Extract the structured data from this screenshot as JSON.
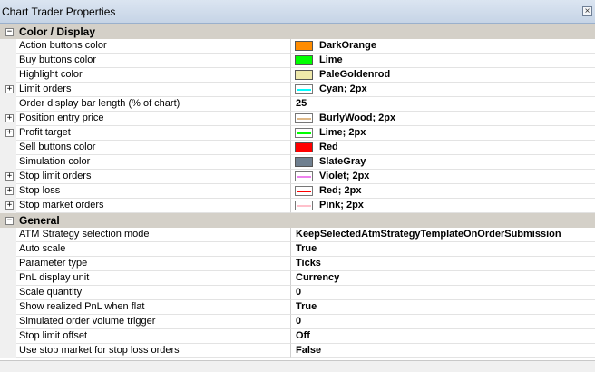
{
  "window": {
    "title": "Chart Trader Properties",
    "close_glyph": "×"
  },
  "categories": [
    {
      "label": "Color / Display",
      "expander": "−",
      "rows": [
        {
          "name": "Action buttons color",
          "value": "DarkOrange",
          "kind": "color",
          "color": "#ff8c00"
        },
        {
          "name": "Buy buttons color",
          "value": "Lime",
          "kind": "color",
          "color": "#00ff00"
        },
        {
          "name": "Highlight color",
          "value": "PaleGoldenrod",
          "kind": "color",
          "color": "#eee8aa"
        },
        {
          "name": "Limit orders",
          "value": "Cyan; 2px",
          "kind": "stroke",
          "color": "#00ffff",
          "expandable": true
        },
        {
          "name": "Order display bar length (% of chart)",
          "value": "25",
          "kind": "text"
        },
        {
          "name": "Position entry price",
          "value": "BurlyWood; 2px",
          "kind": "stroke",
          "color": "#deb887",
          "expandable": true
        },
        {
          "name": "Profit target",
          "value": "Lime; 2px",
          "kind": "stroke",
          "color": "#00ff00",
          "expandable": true
        },
        {
          "name": "Sell buttons color",
          "value": "Red",
          "kind": "color",
          "color": "#ff0000"
        },
        {
          "name": "Simulation color",
          "value": "SlateGray",
          "kind": "color",
          "color": "#708090"
        },
        {
          "name": "Stop limit orders",
          "value": "Violet; 2px",
          "kind": "stroke",
          "color": "#ee82ee",
          "expandable": true
        },
        {
          "name": "Stop loss",
          "value": "Red; 2px",
          "kind": "stroke",
          "color": "#ff0000",
          "expandable": true
        },
        {
          "name": "Stop market orders",
          "value": "Pink; 2px",
          "kind": "stroke",
          "color": "#ffc0cb",
          "expandable": true
        }
      ]
    },
    {
      "label": "General",
      "expander": "−",
      "rows": [
        {
          "name": "ATM Strategy selection mode",
          "value": "KeepSelectedAtmStrategyTemplateOnOrderSubmission",
          "kind": "text"
        },
        {
          "name": "Auto scale",
          "value": "True",
          "kind": "text"
        },
        {
          "name": "Parameter type",
          "value": "Ticks",
          "kind": "text"
        },
        {
          "name": "PnL display unit",
          "value": "Currency",
          "kind": "text"
        },
        {
          "name": "Scale quantity",
          "value": "0",
          "kind": "text"
        },
        {
          "name": "Show realized PnL when flat",
          "value": "True",
          "kind": "text"
        },
        {
          "name": "Simulated order volume trigger",
          "value": "0",
          "kind": "text"
        },
        {
          "name": "Stop limit offset",
          "value": "Off",
          "kind": "text"
        },
        {
          "name": "Use stop market for stop loss orders",
          "value": "False",
          "kind": "text"
        }
      ]
    }
  ],
  "row_expander_glyph": "+"
}
